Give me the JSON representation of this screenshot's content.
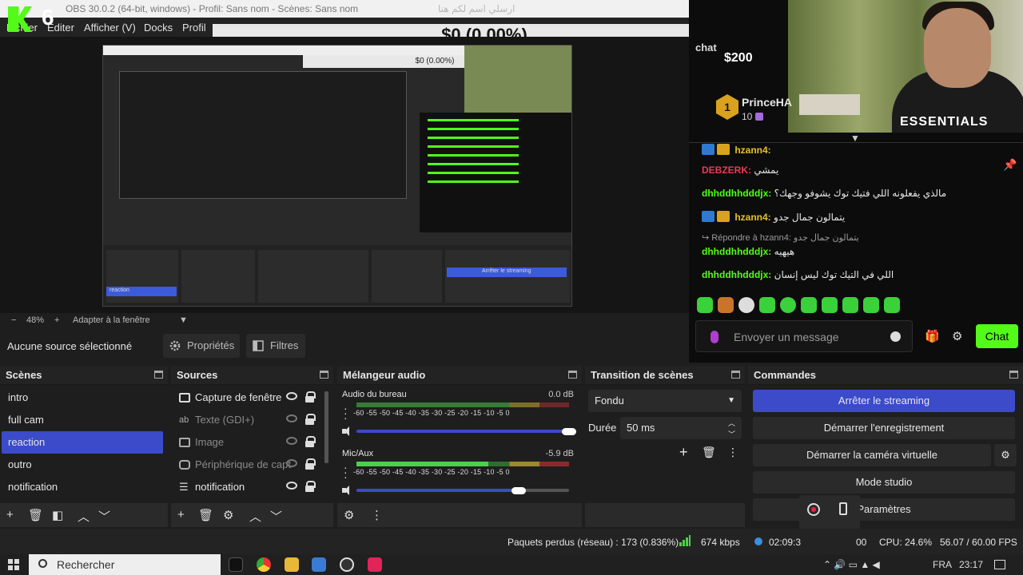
{
  "window": {
    "title": "OBS 30.0.2 (64-bit, windows) - Profil: Sans nom - Scènes: Sans nom",
    "center_text": "ارسلي اسم لكم هنا"
  },
  "logo": {
    "number": "6"
  },
  "menu": {
    "items": [
      "Fichier",
      "Editer",
      "Afficher (V)",
      "Docks",
      "Profil"
    ]
  },
  "donation_bar": "$0 (0.00%)",
  "preview": {
    "mini_donation": "$0 (0.00%)",
    "mini_scene_label": "reaction",
    "mini_cmd_label": "Arrêter le streaming"
  },
  "zoom": {
    "minus": "−",
    "value": "48%",
    "plus": "+",
    "fit": "Adapter à la fenêtre"
  },
  "props": {
    "no_selection": "Aucune source sélectionné",
    "properties": "Propriétés",
    "filters": "Filtres"
  },
  "chat": {
    "label": "chat",
    "gift_amount": "$200",
    "top_gifter": {
      "rank": "1",
      "name": "PrinceHA",
      "count": "10"
    },
    "messages": [
      {
        "user": "hzann4:",
        "text": "",
        "color": "#e6c229"
      },
      {
        "user": "DEBZERK:",
        "text": "يمشي",
        "color": "#e83a58"
      },
      {
        "user": "dhhddhhdddjx:",
        "text": "مالذي يفعلونه اللي فتيك توك يشوفو وجهك؟",
        "color": "#53fc18"
      },
      {
        "user": "hzann4:",
        "text": "يتمالون جمال جدو",
        "color": "#e6c229"
      },
      {
        "user": "↪ Répondre à hzann4:",
        "text": "يتمالون جمال جدو",
        "color": "#9a9a9a"
      },
      {
        "user": "dhhddhhdddjx:",
        "text": "هيهيه",
        "color": "#53fc18"
      },
      {
        "user": "dhhddhhdddjx:",
        "text": "اللي في التيك توك ليس إنسان",
        "color": "#53fc18"
      }
    ],
    "input_placeholder": "Envoyer un message",
    "send_label": "Chat"
  },
  "scenes": {
    "title": "Scènes",
    "items": [
      "intro",
      "full cam",
      "reaction",
      "outro",
      "notification"
    ],
    "selected": "reaction"
  },
  "sources": {
    "title": "Sources",
    "items": [
      "Capture de fenêtre",
      "Texte (GDI+)",
      "Image",
      "Périphérique de capture",
      "notification"
    ]
  },
  "mixer": {
    "title": "Mélangeur audio",
    "channels": [
      {
        "name": "Audio du bureau",
        "db": "0.0 dB",
        "volume": 1.0
      },
      {
        "name": "Mic/Aux",
        "db": "-5.9 dB",
        "volume": 0.74
      }
    ],
    "scale": "-60 -55 -50 -45 -40 -35 -30 -25 -20 -15 -10 -5 0"
  },
  "transitions": {
    "title": "Transition de scènes",
    "type": "Fondu",
    "duration_label": "Durée",
    "duration": "50 ms"
  },
  "commands": {
    "title": "Commandes",
    "stop_stream": "Arrêter le streaming",
    "start_record": "Démarrer l'enregistrement",
    "virtual_cam": "Démarrer la caméra virtuelle",
    "studio": "Mode studio",
    "settings": "Paramètres"
  },
  "status": {
    "dropped": "Paquets perdus (réseau) : 173 (0.836%)",
    "bitrate": "674 kbps",
    "stream_time": "02:09:3",
    "rec_time": "00",
    "cpu": "CPU: 24.6%",
    "fps": "56.07 / 60.00 FPS"
  },
  "taskbar": {
    "search_placeholder": "Rechercher",
    "language": "FRA",
    "time": "23:17"
  },
  "colors": {
    "accent": "#3b4bc9",
    "kick_green": "#53fc18"
  }
}
